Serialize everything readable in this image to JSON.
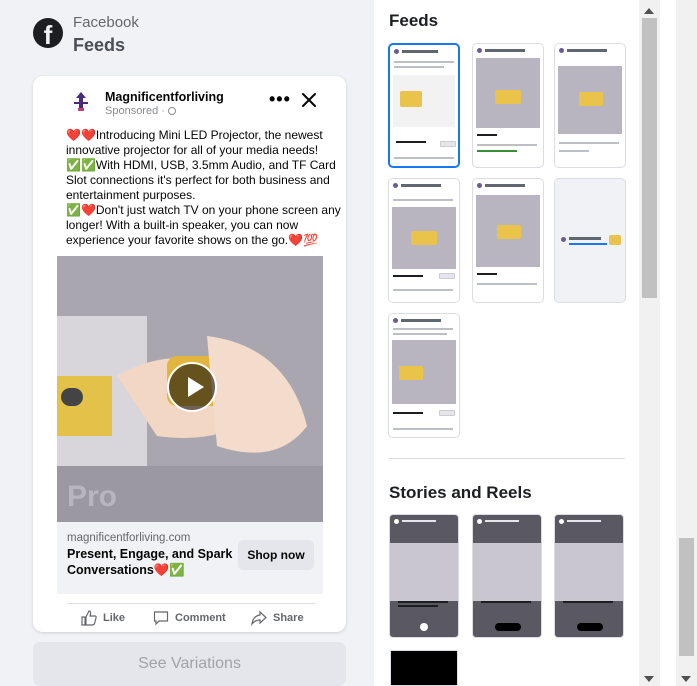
{
  "preview": {
    "platform": "Facebook",
    "placement": "Feeds",
    "post": {
      "page_name": "Magnificentforliving",
      "sponsored_label": "Sponsored · ",
      "primary_text": [
        "❤️❤️Introducing Mini LED Projector, the newest innovative projector for all of your media needs!",
        "✅✅With HDMI, USB, 3.5mm Audio, and TF Card Slot connections it's perfect for both business and entertainment purposes.",
        "✅❤️Don't just watch TV on your phone screen any longer! With a built-in speaker, you can now experience your favorite shows on the go.❤️💯"
      ],
      "video_watermark": "Pro",
      "link_domain": "magnificentforliving.com",
      "headline": "Present, Engage, and Spark Conversations❤️✅",
      "cta_label": "Shop now",
      "actions": {
        "like": "Like",
        "comment": "Comment",
        "share": "Share"
      }
    },
    "see_variations_label": "See Variations"
  },
  "placements": {
    "feeds_title": "Feeds",
    "stories_title": "Stories and Reels"
  },
  "colors": {
    "accent": "#1877f2",
    "panel_bg": "#f0f2f5"
  }
}
